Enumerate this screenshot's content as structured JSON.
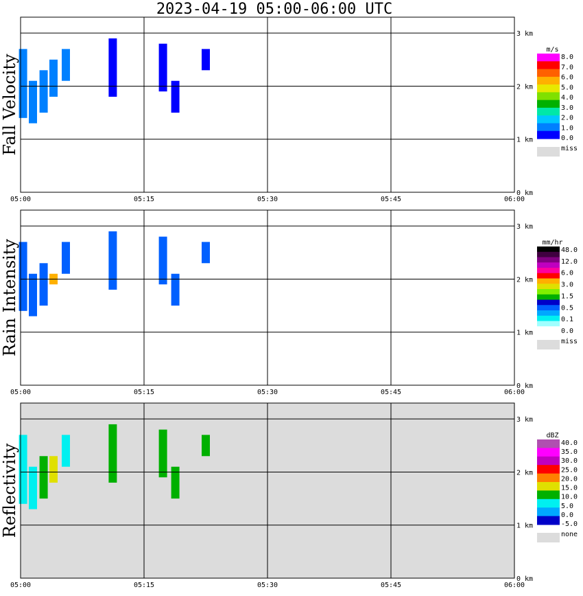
{
  "title": "2023-04-19  05:00-06:00 UTC",
  "x_ticks": [
    "05:00",
    "05:15",
    "05:30",
    "05:45",
    "06:00"
  ],
  "y_ticks": [
    "0 km",
    "1 km",
    "2 km",
    "3 km"
  ],
  "chart_data": [
    {
      "type": "heatmap",
      "ylabel": "Fall Velocity",
      "units": "m/s",
      "x_range": [
        "05:00",
        "06:00"
      ],
      "ylim_km": [
        0,
        3.3
      ],
      "background": "white",
      "legend": {
        "colors": [
          "#0000ff",
          "#0080ff",
          "#00c8ff",
          "#00e8a8",
          "#00b000",
          "#80e000",
          "#e8e800",
          "#ffb000",
          "#ff6000",
          "#ff0000",
          "#ff00ff"
        ],
        "labels": [
          "8.0",
          "7.0",
          "6.0",
          "5.0",
          "4.0",
          "3.0",
          "2.0",
          "1.0",
          "0.0"
        ],
        "missing_label": "miss"
      },
      "cells": [
        {
          "t_min": 0.3,
          "h_km": [
            1.4,
            2.7
          ],
          "value": 1.0
        },
        {
          "t_min": 1.5,
          "h_km": [
            1.3,
            2.1
          ],
          "value": 1.0
        },
        {
          "t_min": 2.8,
          "h_km": [
            1.5,
            2.3
          ],
          "value": 1.5
        },
        {
          "t_min": 4.0,
          "h_km": [
            1.8,
            2.5
          ],
          "value": 1.2
        },
        {
          "t_min": 5.5,
          "h_km": [
            2.1,
            2.7
          ],
          "value": 1.0
        },
        {
          "t_min": 11.2,
          "h_km": [
            1.8,
            2.9
          ],
          "value": 0.8
        },
        {
          "t_min": 17.3,
          "h_km": [
            1.9,
            2.8
          ],
          "value": 0.8
        },
        {
          "t_min": 18.8,
          "h_km": [
            1.5,
            2.1
          ],
          "value": 0.8
        },
        {
          "t_min": 22.5,
          "h_km": [
            2.3,
            2.7
          ],
          "value": 0.8
        }
      ]
    },
    {
      "type": "heatmap",
      "ylabel": "Rain Intensity",
      "units": "mm/hr",
      "x_range": [
        "05:00",
        "06:00"
      ],
      "ylim_km": [
        0,
        3.3
      ],
      "background": "white",
      "legend": {
        "colors": [
          "#ffffff",
          "#a0ffff",
          "#00f0f0",
          "#00a8ff",
          "#0060ff",
          "#0000c8",
          "#00b000",
          "#80f000",
          "#e0e000",
          "#ffb000",
          "#ff0000",
          "#ff00a0",
          "#c000c0",
          "#800080",
          "#400040",
          "#000000"
        ],
        "labels": [
          "48.0",
          "12.0",
          "6.0",
          "3.0",
          "1.5",
          "0.5",
          "0.1",
          "0.0"
        ],
        "missing_label": "miss"
      },
      "cells": [
        {
          "t_min": 0.3,
          "h_km": [
            1.4,
            2.7
          ],
          "value": 0.5
        },
        {
          "t_min": 1.5,
          "h_km": [
            1.3,
            2.1
          ],
          "value": 0.5
        },
        {
          "t_min": 2.8,
          "h_km": [
            1.5,
            2.3
          ],
          "value": 1.0
        },
        {
          "t_min": 4.0,
          "h_km": [
            1.9,
            2.1
          ],
          "value": 3.0
        },
        {
          "t_min": 5.5,
          "h_km": [
            2.1,
            2.7
          ],
          "value": 0.5
        },
        {
          "t_min": 11.2,
          "h_km": [
            1.8,
            2.9
          ],
          "value": 1.0
        },
        {
          "t_min": 17.3,
          "h_km": [
            1.9,
            2.8
          ],
          "value": 1.0
        },
        {
          "t_min": 18.8,
          "h_km": [
            1.5,
            2.1
          ],
          "value": 1.0
        },
        {
          "t_min": 22.5,
          "h_km": [
            2.3,
            2.7
          ],
          "value": 1.0
        }
      ]
    },
    {
      "type": "heatmap",
      "ylabel": "Reflectivity",
      "units": "dBZ",
      "x_range": [
        "05:00",
        "06:00"
      ],
      "ylim_km": [
        0,
        3.3
      ],
      "background": "gray",
      "legend": {
        "colors": [
          "#0000c8",
          "#00a8ff",
          "#00f0f0",
          "#00b000",
          "#e0e000",
          "#ff8000",
          "#ff0000",
          "#c000c0",
          "#ff00ff",
          "#b050b0"
        ],
        "labels": [
          "40.0",
          "35.0",
          "30.0",
          "25.0",
          "20.0",
          "15.0",
          "10.0",
          "5.0",
          "0.0",
          "-5.0"
        ],
        "missing_label": "none"
      },
      "cells": [
        {
          "t_min": 0.3,
          "h_km": [
            1.4,
            2.7
          ],
          "value": 5.0
        },
        {
          "t_min": 1.5,
          "h_km": [
            1.3,
            2.1
          ],
          "value": 7.0
        },
        {
          "t_min": 2.8,
          "h_km": [
            1.5,
            2.3
          ],
          "value": 10.0
        },
        {
          "t_min": 4.0,
          "h_km": [
            1.8,
            2.3
          ],
          "value": 15.0
        },
        {
          "t_min": 5.5,
          "h_km": [
            2.1,
            2.7
          ],
          "value": 8.0
        },
        {
          "t_min": 11.2,
          "h_km": [
            1.8,
            2.9
          ],
          "value": 12.0
        },
        {
          "t_min": 17.3,
          "h_km": [
            1.9,
            2.8
          ],
          "value": 12.0
        },
        {
          "t_min": 18.8,
          "h_km": [
            1.5,
            2.1
          ],
          "value": 10.0
        },
        {
          "t_min": 22.5,
          "h_km": [
            2.3,
            2.7
          ],
          "value": 12.0
        }
      ]
    }
  ]
}
